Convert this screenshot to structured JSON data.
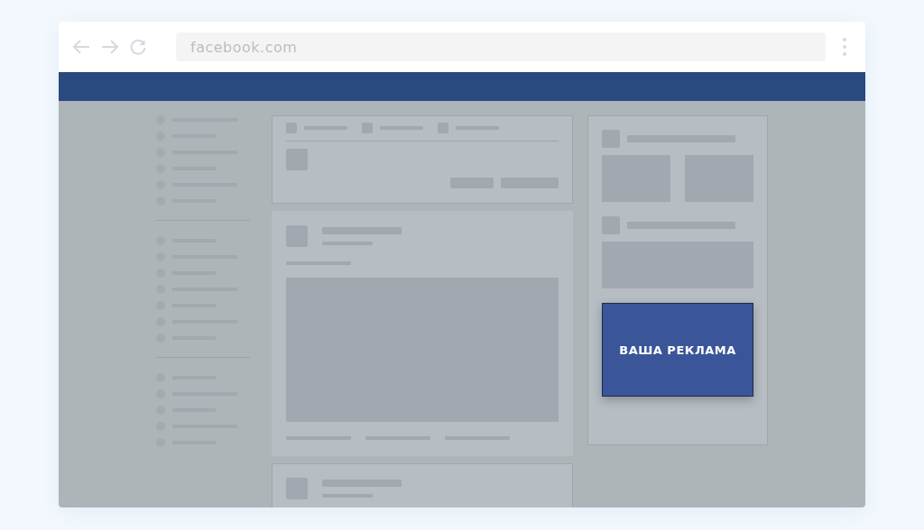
{
  "browser": {
    "address": "facebook.com"
  },
  "ad": {
    "label": "ВАША РЕКЛАМА"
  }
}
